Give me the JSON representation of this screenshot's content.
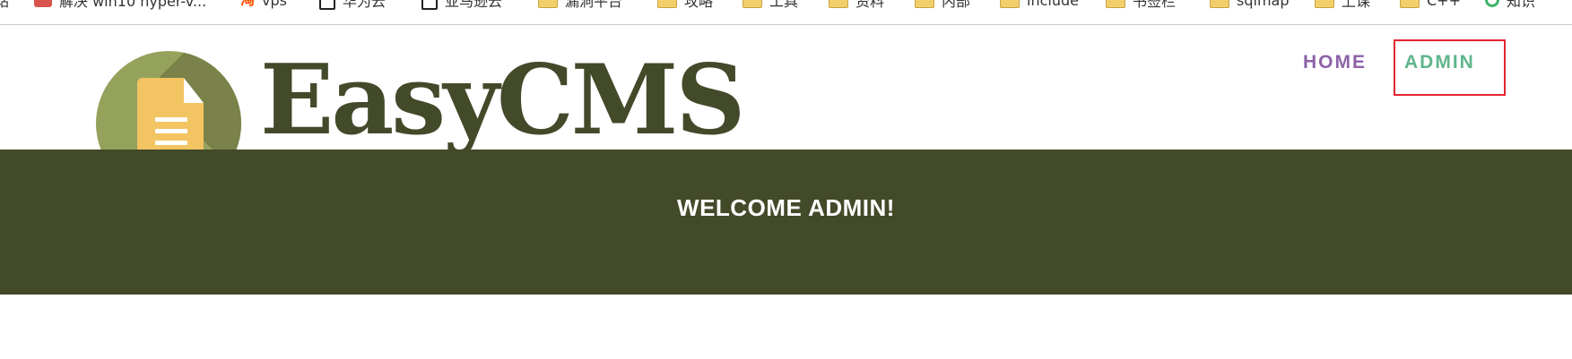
{
  "bookmarks": [
    {
      "label": "解决 win10 hyper-v...",
      "icon": "bookmark-red-icon"
    },
    {
      "label": "vps",
      "icon": "taobao-icon"
    },
    {
      "label": "华为云",
      "icon": "page-icon"
    },
    {
      "label": "亚马逊云",
      "icon": "page-icon"
    },
    {
      "label": "漏洞平台",
      "icon": "folder-icon"
    },
    {
      "label": "攻略",
      "icon": "folder-icon"
    },
    {
      "label": "工具",
      "icon": "folder-icon"
    },
    {
      "label": "资料",
      "icon": "folder-icon"
    },
    {
      "label": "内部",
      "icon": "folder-icon"
    },
    {
      "label": "include",
      "icon": "folder-icon"
    },
    {
      "label": "书签栏",
      "icon": "folder-icon"
    },
    {
      "label": "sqlmap",
      "icon": "folder-icon"
    },
    {
      "label": "上课",
      "icon": "folder-icon"
    },
    {
      "label": "C++",
      "icon": "folder-icon"
    },
    {
      "label": "知识",
      "icon": "ring-icon"
    }
  ],
  "brand": {
    "name": "EasyCMS"
  },
  "nav": {
    "home": "HOME",
    "admin": "ADMIN"
  },
  "banner": {
    "welcome": "WELCOME ADMIN!"
  },
  "colors": {
    "brand_dark": "#434a2a",
    "logo_green": "#95a25c",
    "doc_yellow": "#f3c462",
    "nav_home": "#8d62a8",
    "nav_admin": "#5fb58a",
    "highlight": "#e32530"
  }
}
